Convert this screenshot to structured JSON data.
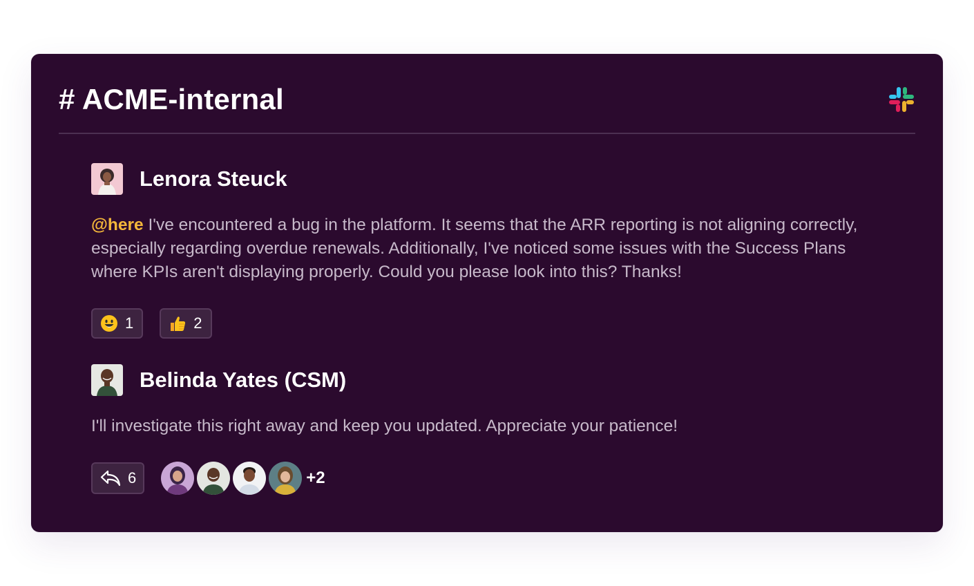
{
  "channel": {
    "title": "# ACME-internal",
    "app_icon": "slack-logo-icon"
  },
  "messages": [
    {
      "author": "Lenora Steuck",
      "mention": "@here",
      "text": " I've encountered a bug in the platform. It seems that the ARR reporting is not aligning correctly, especially regarding overdue renewals. Additionally, I've noticed some issues with the Success Plans where KPIs aren't displaying properly. Could you please look into this? Thanks!",
      "reactions": [
        {
          "emoji": "smiley-face-icon",
          "count": "1"
        },
        {
          "emoji": "thumbs-up-icon",
          "count": "2"
        }
      ]
    },
    {
      "author": "Belinda Yates (CSM)",
      "text": "I'll investigate this right away and keep you updated. Appreciate your patience!",
      "thread": {
        "reply_icon": "reply-arrow-icon",
        "reply_count": "6",
        "more_participants": "+2"
      }
    }
  ],
  "colors": {
    "card_background": "#2b0a2e",
    "mention": "#f4b73a",
    "body_text": "#c7b9ca"
  }
}
